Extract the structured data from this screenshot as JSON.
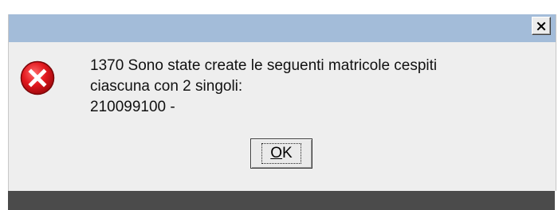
{
  "dialog": {
    "close_icon": "close-x-icon",
    "status_icon": "error-icon",
    "message_lines": [
      "1370 Sono state create le seguenti matricole cespiti",
      "ciascuna con 2 singoli:",
      "210099100 -"
    ],
    "ok_button": {
      "mnemonic": "O",
      "rest": "K"
    }
  },
  "colors": {
    "titlebar": "#a3bcd9",
    "dialog_bg": "#eeeeee",
    "error_red": "#d9161c",
    "bottom_bar": "#4b4b4b"
  }
}
